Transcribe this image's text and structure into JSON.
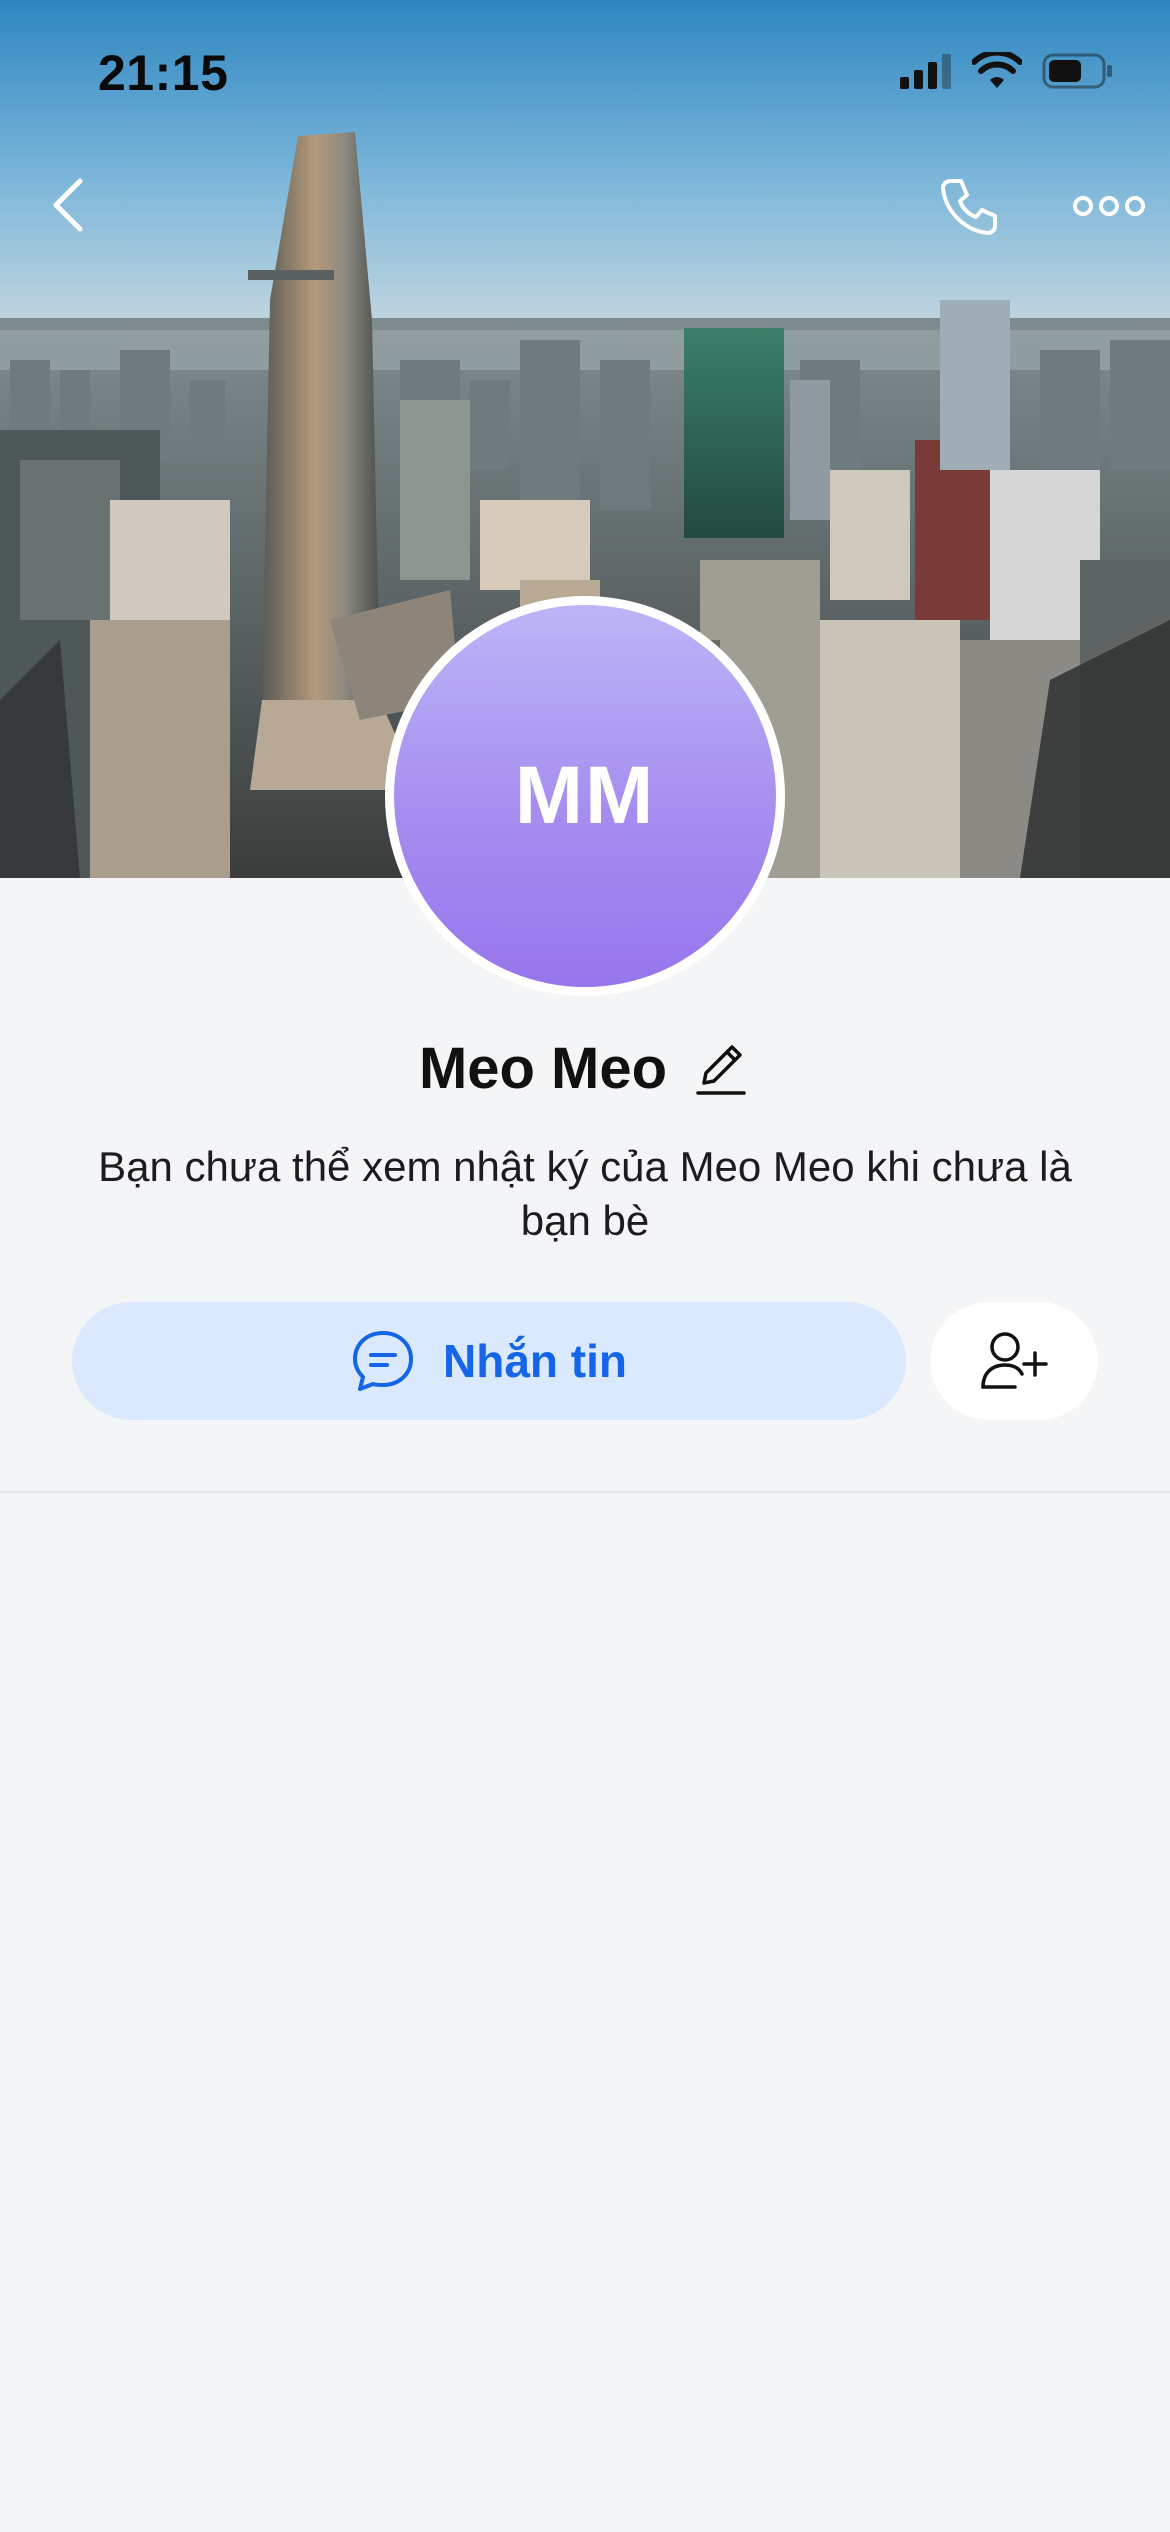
{
  "status_bar": {
    "time": "21:15",
    "icons": [
      "cellular-signal-icon",
      "wifi-icon",
      "battery-icon"
    ]
  },
  "nav": {
    "back_icon": "chevron-left-icon",
    "call_icon": "phone-icon",
    "more_icon": "more-horizontal-icon"
  },
  "profile": {
    "initials": "MM",
    "name": "Meo Meo",
    "edit_icon": "pencil-icon",
    "notice": "Bạn chưa thể xem nhật ký của Meo Meo khi chưa là bạn bè"
  },
  "actions": {
    "message_label": "Nhắn tin",
    "message_icon": "chat-bubble-icon",
    "add_friend_icon": "add-user-icon"
  },
  "colors": {
    "primary": "#1565e8",
    "message_button_bg": "#dbe9ff",
    "avatar_gradient_top": "#bcb5f6",
    "avatar_gradient_bottom": "#9775ec",
    "background": "#f4f5f7"
  }
}
